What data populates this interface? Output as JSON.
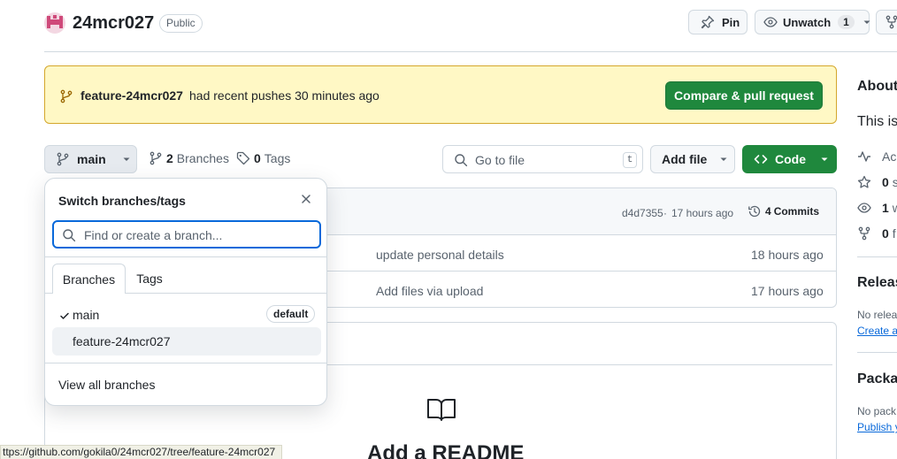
{
  "repo": {
    "name": "24mcr027",
    "visibility": "Public"
  },
  "header_actions": {
    "pin": "Pin",
    "unwatch": "Unwatch",
    "watch_count": "1"
  },
  "banner": {
    "branch": "feature-24mcr027",
    "message": "had recent pushes 30 minutes ago",
    "compare_button": "Compare & pull request"
  },
  "toolbar": {
    "branch": "main",
    "branches_count": "2",
    "branches_label": "Branches",
    "tags_count": "0",
    "tags_label": "Tags",
    "go_to_file_placeholder": "Go to file",
    "go_to_file_shortcut": "t",
    "add_file": "Add file",
    "code": "Code"
  },
  "commit_bar": {
    "hash": "d4d7355",
    "time": "17 hours ago",
    "commits_count": "4",
    "commits_label": "Commits"
  },
  "files": [
    {
      "message": "update personal details",
      "time": "18 hours ago"
    },
    {
      "message": "Add files via upload",
      "time": "17 hours ago"
    }
  ],
  "readme": {
    "title": "Add a README"
  },
  "dropdown": {
    "title": "Switch branches/tags",
    "search_placeholder": "Find or create a branch...",
    "tab_branches": "Branches",
    "tab_tags": "Tags",
    "branches": [
      {
        "name": "main",
        "badge": "default",
        "checked": true
      },
      {
        "name": "feature-24mcr027",
        "badge": "",
        "checked": false
      }
    ],
    "view_all": "View all branches"
  },
  "sidebar": {
    "about_heading": "About",
    "about_text": "This is",
    "activity": "Ac",
    "stars": "0",
    "stars_suffix": "s",
    "watching": "1",
    "watching_suffix": "w",
    "forks": "0",
    "forks_suffix": "f",
    "releases_heading": "Releas",
    "releases_text": "No relea",
    "releases_link": "Create a",
    "packages_heading": "Packa",
    "packages_text": "No pack",
    "packages_link": "Publish y"
  },
  "status_url": "ttps://github.com/gokila0/24mcr027/tree/feature-24mcr027",
  "colors": {
    "accent_green": "#1f883d",
    "banner_bg": "#fff8c5",
    "banner_border": "#d4a72c",
    "link_blue": "#0969da",
    "avatar": "#cf4a7a"
  }
}
